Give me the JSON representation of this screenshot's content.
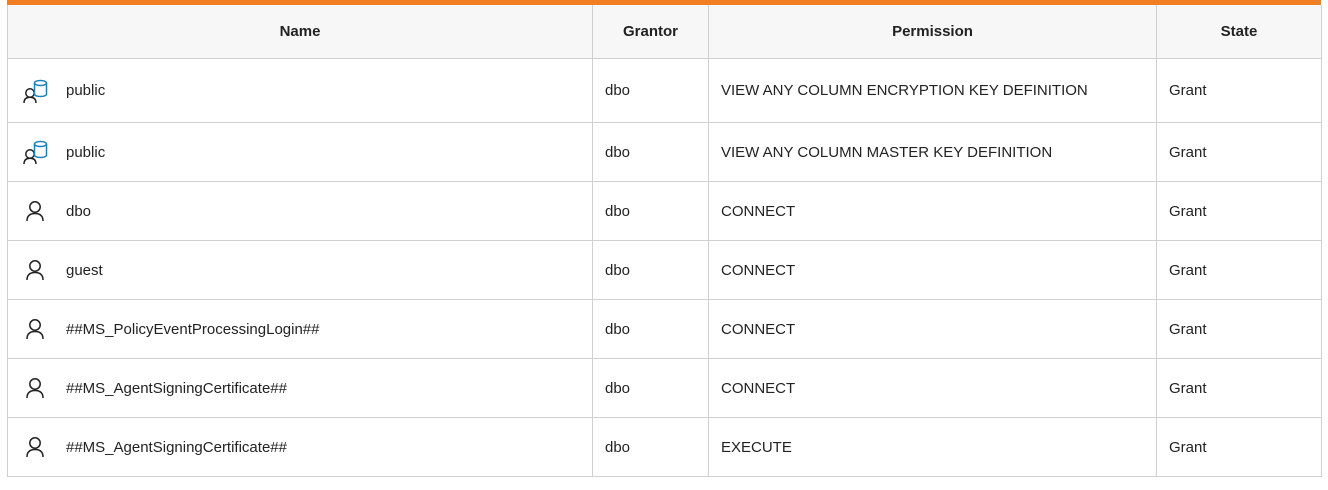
{
  "table": {
    "columns": {
      "name": "Name",
      "grantor": "Grantor",
      "permission": "Permission",
      "state": "State"
    },
    "rows": [
      {
        "icon": "database-role-icon",
        "name": "public",
        "grantor": "dbo",
        "permission": "VIEW ANY COLUMN ENCRYPTION KEY DEFINITION",
        "state": "Grant"
      },
      {
        "icon": "database-role-icon",
        "name": "public",
        "grantor": "dbo",
        "permission": "VIEW ANY COLUMN MASTER KEY DEFINITION",
        "state": "Grant"
      },
      {
        "icon": "user-icon",
        "name": "dbo",
        "grantor": "dbo",
        "permission": "CONNECT",
        "state": "Grant"
      },
      {
        "icon": "user-icon",
        "name": "guest",
        "grantor": "dbo",
        "permission": "CONNECT",
        "state": "Grant"
      },
      {
        "icon": "user-icon",
        "name": "##MS_PolicyEventProcessingLogin##",
        "grantor": "dbo",
        "permission": "CONNECT",
        "state": "Grant"
      },
      {
        "icon": "user-icon",
        "name": "##MS_AgentSigningCertificate##",
        "grantor": "dbo",
        "permission": "CONNECT",
        "state": "Grant"
      },
      {
        "icon": "user-icon",
        "name": "##MS_AgentSigningCertificate##",
        "grantor": "dbo",
        "permission": "EXECUTE",
        "state": "Grant"
      }
    ]
  },
  "colors": {
    "accent": "#f07f24",
    "role_icon": "#1a82b8",
    "user_icon": "#222222"
  }
}
